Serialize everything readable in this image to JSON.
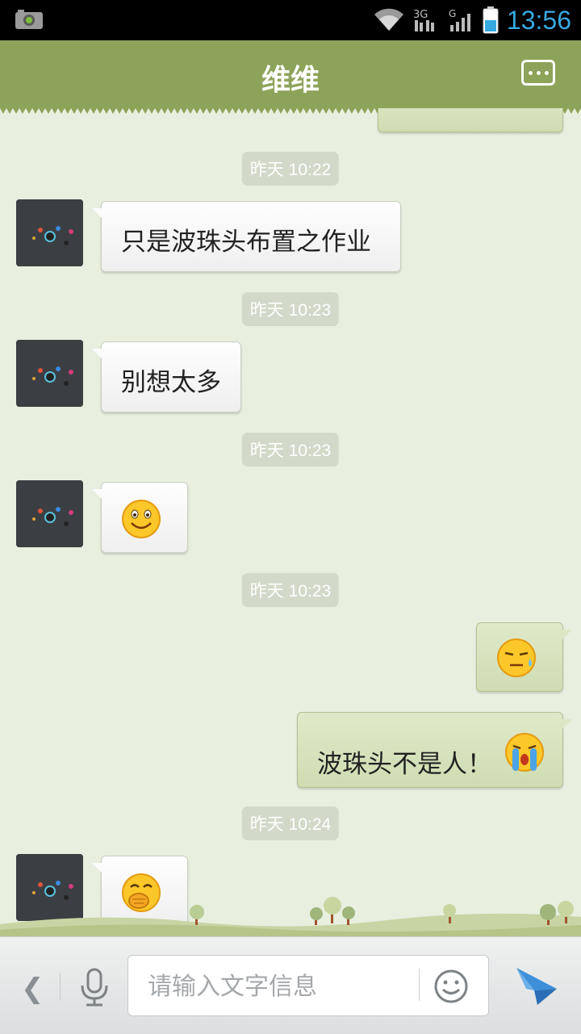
{
  "status_bar": {
    "time": "13:56",
    "icons": [
      "camera-icon",
      "wifi-icon",
      "network-3g-icon",
      "signal-icon",
      "battery-icon"
    ]
  },
  "header": {
    "title": "维维",
    "menu_icon": "more-icon"
  },
  "messages": [
    {
      "type": "time",
      "text": "昨天 10:22"
    },
    {
      "type": "incoming",
      "text": "只是波珠头布置之作业"
    },
    {
      "type": "time",
      "text": "昨天 10:23"
    },
    {
      "type": "incoming",
      "text": "别想太多"
    },
    {
      "type": "time",
      "text": "昨天 10:23"
    },
    {
      "type": "incoming",
      "emoji": "smile-emoji"
    },
    {
      "type": "time",
      "text": "昨天 10:23"
    },
    {
      "type": "outgoing",
      "emoji": "sweat-emoji"
    },
    {
      "type": "outgoing",
      "text": "波珠头不是人！",
      "emoji": "crying-emoji"
    },
    {
      "type": "time",
      "text": "昨天 10:24"
    },
    {
      "type": "incoming",
      "emoji": "giggle-emoji"
    }
  ],
  "input_bar": {
    "placeholder": "请输入文字信息",
    "back_icon": "chevron-left-icon",
    "voice_icon": "microphone-icon",
    "emoji_icon": "smiley-icon",
    "send_icon": "send-icon"
  },
  "colors": {
    "header": "#8ea35a",
    "chat_background": "#e8efdf",
    "outgoing_bubble": "#d4e0ba",
    "incoming_bubble": "#f8f8f8",
    "clock": "#36a9e1"
  }
}
